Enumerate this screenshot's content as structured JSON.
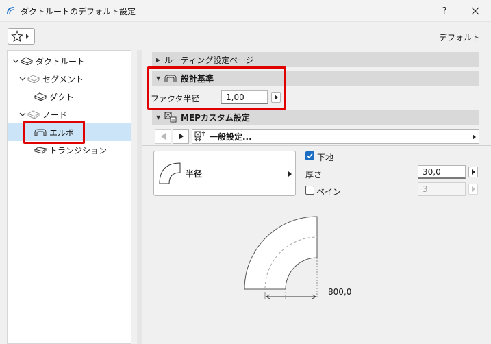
{
  "window": {
    "title": "ダクトルートのデフォルト設定",
    "help_label": "?"
  },
  "toolbar": {
    "default_label": "デフォルト"
  },
  "tree": {
    "items": [
      {
        "label": "ダクトルート",
        "level": 0,
        "expanded": true
      },
      {
        "label": "セグメント",
        "level": 1,
        "expanded": true
      },
      {
        "label": "ダクト",
        "level": 2
      },
      {
        "label": "ノード",
        "level": 1,
        "expanded": true
      },
      {
        "label": "エルボ",
        "level": 2,
        "selected": true
      },
      {
        "label": "トランジション",
        "level": 2
      }
    ]
  },
  "sections": {
    "routing": {
      "label": "ルーティング設定ページ",
      "expanded": false
    },
    "design": {
      "label": "設計基準",
      "expanded": true,
      "factor_label": "ファクタ半径",
      "factor_value": "1,00"
    },
    "mep": {
      "label": "MEPカスタム設定",
      "expanded": true
    }
  },
  "nav": {
    "selected": "一般設定..."
  },
  "shape": {
    "label": "半径"
  },
  "options": {
    "substrate": {
      "label": "下地",
      "checked": true
    },
    "thickness": {
      "label": "厚さ",
      "value": "30,0"
    },
    "vane": {
      "label": "ベイン",
      "checked": false,
      "value": "3"
    }
  },
  "preview": {
    "dimension": "800,0"
  },
  "colors": {
    "accent": "#1a6fc4",
    "highlight": "#e00000",
    "selection": "#cce4f7"
  }
}
